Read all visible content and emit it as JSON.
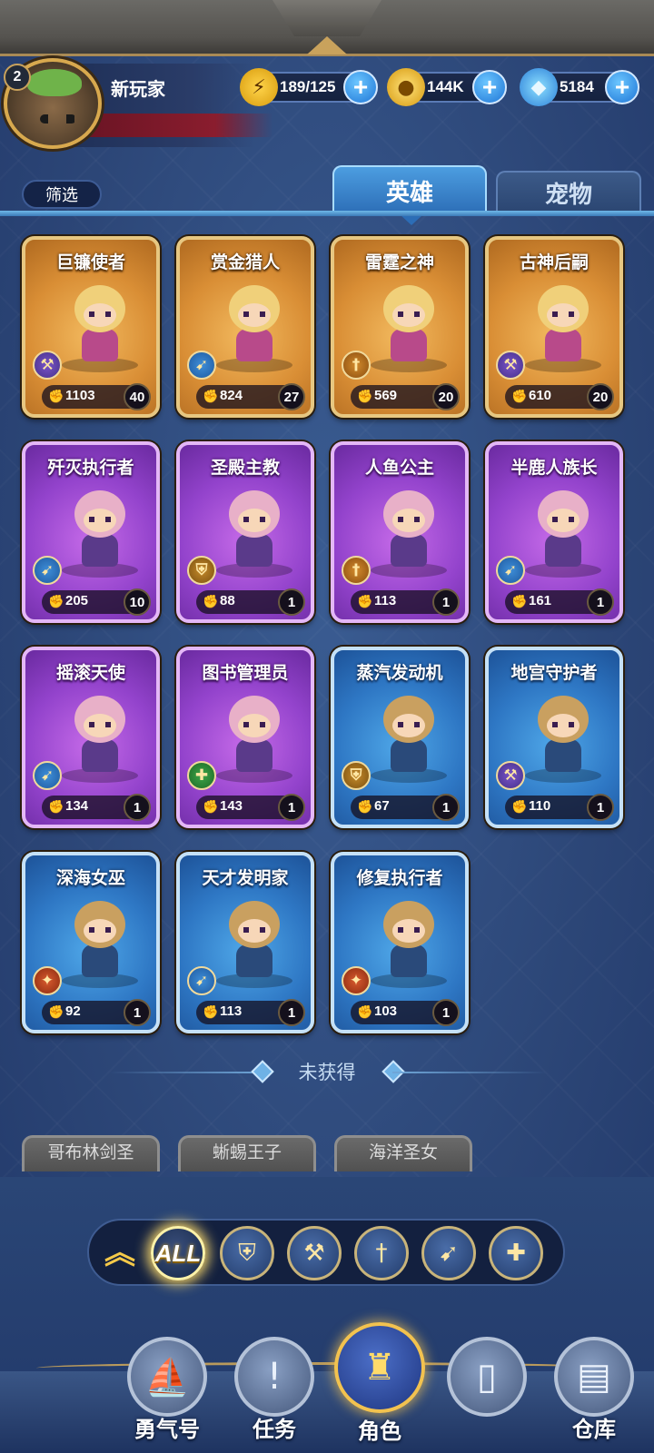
{
  "player": {
    "level": "2",
    "name": "新玩家"
  },
  "currencies": {
    "energy": "189/125",
    "gold": "144K",
    "gems": "5184",
    "plus": "+"
  },
  "filter_label": "筛选",
  "tabs": {
    "heroes": "英雄",
    "pets": "宠物",
    "active": "heroes"
  },
  "heroes": [
    {
      "name": "巨镰使者",
      "power": "1103",
      "level": "40",
      "rarity": "gold",
      "class_icon": "axe-icon"
    },
    {
      "name": "赏金猎人",
      "power": "824",
      "level": "27",
      "rarity": "gold",
      "class_icon": "bow-icon"
    },
    {
      "name": "雷霆之神",
      "power": "569",
      "level": "20",
      "rarity": "gold",
      "class_icon": "sword-icon"
    },
    {
      "name": "古神后嗣",
      "power": "610",
      "level": "20",
      "rarity": "gold",
      "class_icon": "axe-icon"
    },
    {
      "name": "歼灭执行者",
      "power": "205",
      "level": "10",
      "rarity": "purple",
      "class_icon": "bow-icon"
    },
    {
      "name": "圣殿主教",
      "power": "88",
      "level": "1",
      "rarity": "purple",
      "class_icon": "shield-icon"
    },
    {
      "name": "人鱼公主",
      "power": "113",
      "level": "1",
      "rarity": "purple",
      "class_icon": "sword-icon"
    },
    {
      "name": "半鹿人族长",
      "power": "161",
      "level": "1",
      "rarity": "purple",
      "class_icon": "bow-icon"
    },
    {
      "name": "摇滚天使",
      "power": "134",
      "level": "1",
      "rarity": "purple",
      "class_icon": "bow-icon"
    },
    {
      "name": "图书管理员",
      "power": "143",
      "level": "1",
      "rarity": "purple",
      "class_icon": "cross-icon"
    },
    {
      "name": "蒸汽发动机",
      "power": "67",
      "level": "1",
      "rarity": "blue",
      "class_icon": "shield-icon"
    },
    {
      "name": "地宫守护者",
      "power": "110",
      "level": "1",
      "rarity": "blue",
      "class_icon": "axe-icon"
    },
    {
      "name": "深海女巫",
      "power": "92",
      "level": "1",
      "rarity": "blue",
      "class_icon": "fire-icon"
    },
    {
      "name": "天才发明家",
      "power": "113",
      "level": "1",
      "rarity": "blue",
      "class_icon": "bow-icon"
    },
    {
      "name": "修复执行者",
      "power": "103",
      "level": "1",
      "rarity": "blue",
      "class_icon": "fire-icon"
    }
  ],
  "unobtained_label": "未获得",
  "locked_heroes": [
    "哥布林剑圣",
    "蜥蜴王子",
    "海洋圣女"
  ],
  "class_filters": {
    "all_label": "ALL",
    "selected": "ALL",
    "icons": [
      "shield-icon",
      "axe-icon",
      "sword-icon",
      "bow-icon",
      "cross-icon"
    ]
  },
  "bottom_nav": [
    {
      "label": "勇气号",
      "icon": "ship-icon"
    },
    {
      "label": "任务",
      "icon": "quest-scroll-icon"
    },
    {
      "label": "角色",
      "icon": "helmet-icon",
      "active": true
    },
    {
      "label": "",
      "icon": "card-icon"
    },
    {
      "label": "仓库",
      "icon": "chest-icon"
    }
  ],
  "colors": {
    "gold_card": "#d98e35",
    "purple_card": "#9343cc",
    "blue_card": "#2e77c4",
    "accent_gold": "#f2c24f",
    "tab_blue": "#2c6db6"
  }
}
